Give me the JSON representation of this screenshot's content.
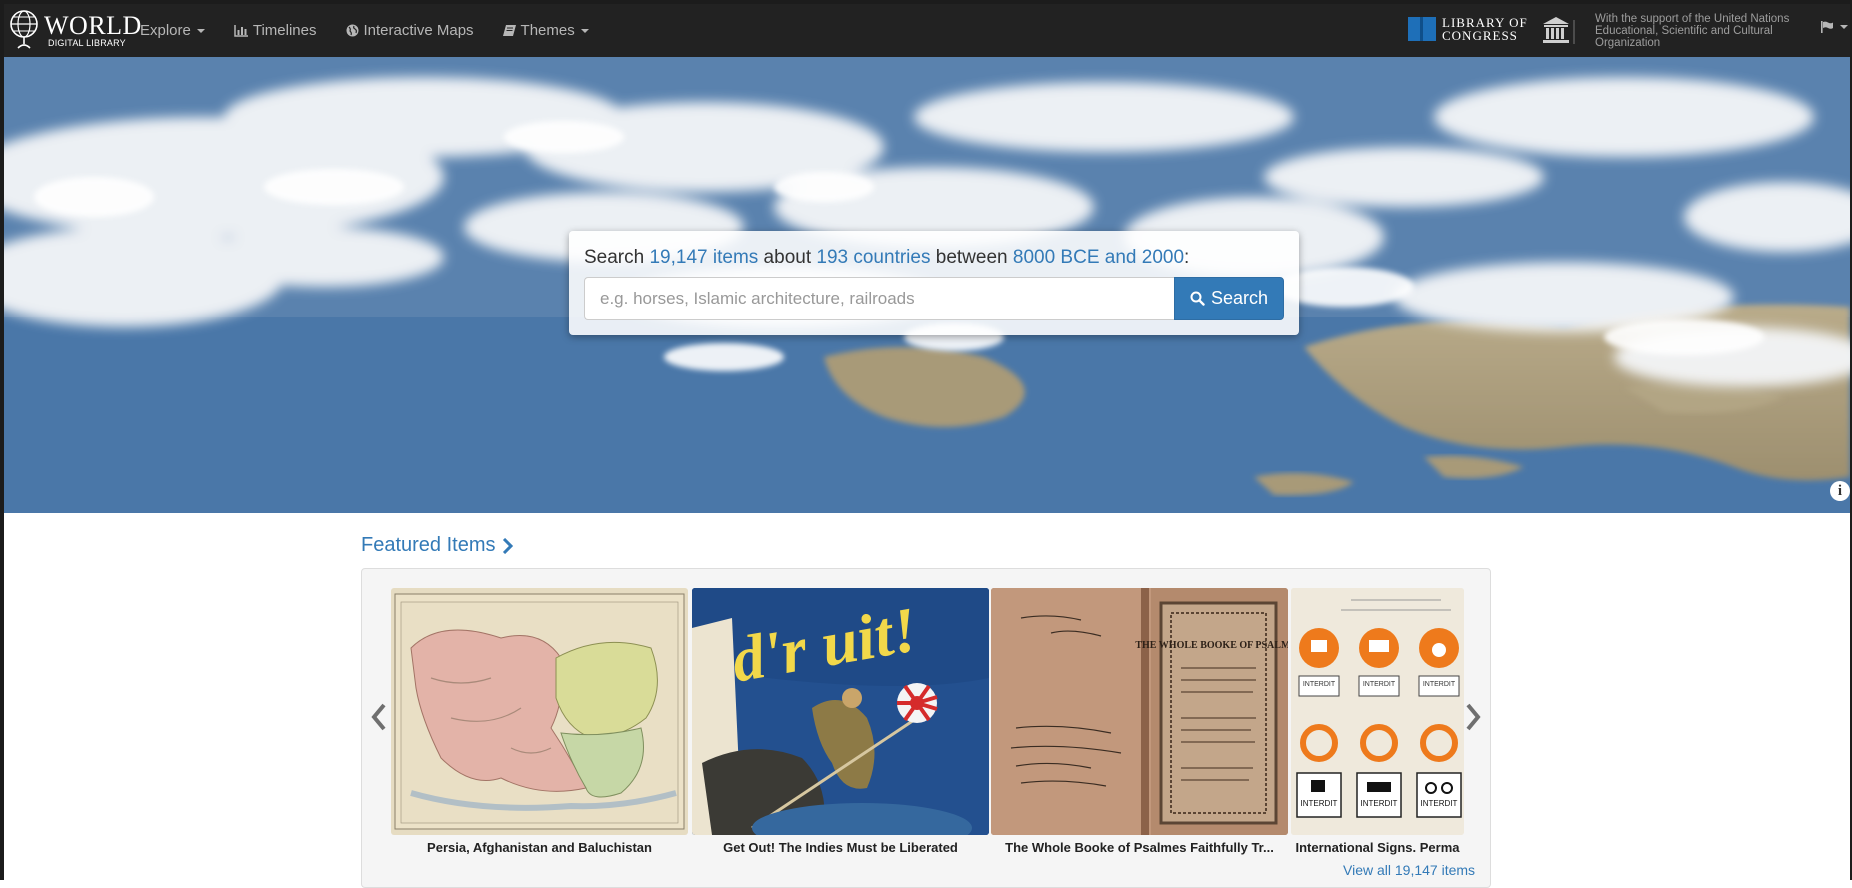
{
  "brand": {
    "world": "WORLD",
    "sub": "DIGITAL LIBRARY"
  },
  "nav": {
    "explore": "Explore",
    "timelines": "Timelines",
    "maps": "Interactive Maps",
    "themes": "Themes"
  },
  "partners": {
    "loc_line1": "LIBRARY OF",
    "loc_line2": "CONGRESS",
    "unesco": "With the support of the United Nations Educational, Scientific and Cultural Organization"
  },
  "search": {
    "prefix": "Search ",
    "items": "19,147 items",
    "about": " about ",
    "countries": "193 countries",
    "between": " between ",
    "range": "8000 BCE and 2000",
    "colon": ":",
    "placeholder": "e.g. horses, Islamic architecture, railroads",
    "button": "Search"
  },
  "featured": {
    "title": "Featured Items",
    "items": [
      {
        "caption": "Persia, Afghanistan and Baluchistan"
      },
      {
        "caption": "Get Out! The Indies Must be Liberated"
      },
      {
        "caption": "The Whole Booke of Psalmes Faithfully Tr..."
      },
      {
        "caption": "International Signs. Perma"
      }
    ],
    "poster_text": "d'r uit!",
    "book_text": "THE WHOLE BOOKE OF PSALMES",
    "signs_text": "INTERDIT",
    "view_all": "View all 19,147 items"
  },
  "colors": {
    "nav_bg": "#222222",
    "link": "#337ab7",
    "button": "#337ab7"
  }
}
